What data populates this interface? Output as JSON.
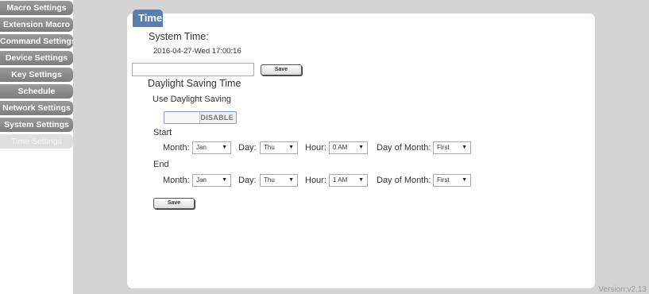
{
  "sidebar": {
    "items": [
      {
        "label": "Macro Settings",
        "active": false
      },
      {
        "label": "Extension Macro",
        "active": false
      },
      {
        "label": "Command Settings",
        "active": false
      },
      {
        "label": "Device Settings",
        "active": false
      },
      {
        "label": "Key Settings",
        "active": false
      },
      {
        "label": "Schedule",
        "active": false
      },
      {
        "label": "Network Settings",
        "active": false
      },
      {
        "label": "System Settings",
        "active": false
      },
      {
        "label": "Time Settings",
        "active": true
      }
    ]
  },
  "panel": {
    "title": "Time",
    "system_time_heading": "System Time:",
    "system_time_value": "2016-04-27-Wed 17:00:16",
    "time_input_value": "",
    "save_label": "Save",
    "dst_heading": "Daylight Saving Time",
    "use_dst_label": "Use Daylight Saving",
    "dst_toggle_state": "DISABLE",
    "start": {
      "heading": "Start",
      "month_label": "Month:",
      "month_value": "Jan",
      "day_label": "Day:",
      "day_value": "Thu",
      "hour_label": "Hour:",
      "hour_value": "0 AM",
      "dom_label": "Day of Month:",
      "dom_value": "First"
    },
    "end": {
      "heading": "End",
      "month_label": "Month:",
      "month_value": "Jan",
      "day_label": "Day:",
      "day_value": "Thu",
      "hour_label": "Hour:",
      "hour_value": "1 AM",
      "dom_label": "Day of Month:",
      "dom_value": "First"
    },
    "save2_label": "Save"
  },
  "footer": {
    "version": "Version:v2.13"
  },
  "icons": {
    "dropdown": "dropdown-caret-icon"
  },
  "colors": {
    "title_bg": "#587fae",
    "nav_bg": "#8a8a8a",
    "toggle_border": "#7a9fc9"
  }
}
